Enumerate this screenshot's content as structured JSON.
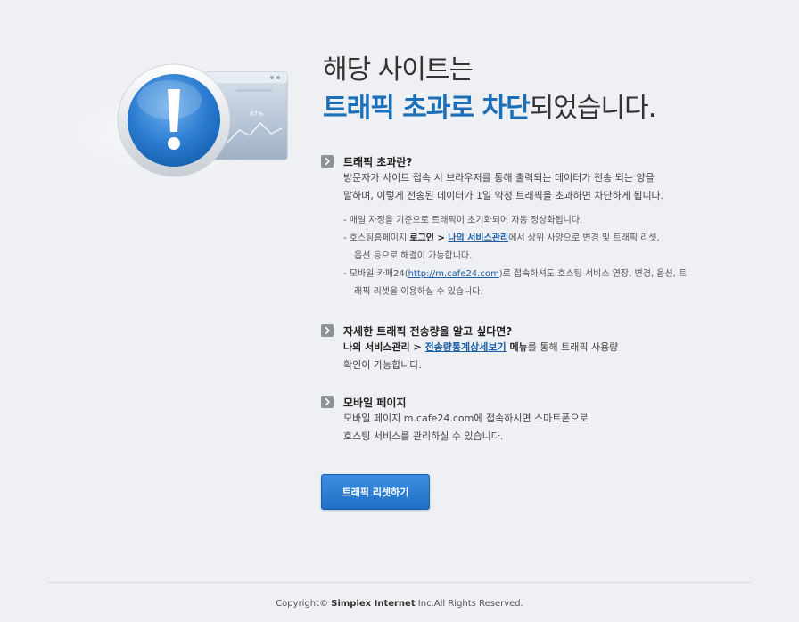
{
  "hero": {
    "title_line1": "해당 사이트는",
    "title_highlight": "트래픽 초과로 차단",
    "title_rest": "되었습니다.",
    "chart_percent": "67%"
  },
  "sections": {
    "what": {
      "title": "트래픽 초과란?",
      "body_line1": "방문자가 사이트 접속 시 브라우저를 통해 출력되는 데이터가 전송 되는 양을",
      "body_line2": "말하며, 이렇게 전송된 데이터가 1일 약정 트래픽을 초과하면 차단하게 됩니다.",
      "note1": "- 매일 자정을 기준으로 트래픽이 초기화되어 자동 정상화됩니다.",
      "note2_prefix": "- 호스팅홈페이지 ",
      "note2_login": "로그인",
      "note2_sep": " > ",
      "note2_link": "나의 서비스관리",
      "note2_suffix": "에서 상위 사양으로 변경 및 트래픽 리셋,",
      "note2_line2": "옵션 등으로 해결이 가능합니다.",
      "note3_prefix": "- 모바일 카페24(",
      "note3_link": "http://m.cafe24.com",
      "note3_suffix": ")로 접속하셔도 호스팅 서비스 연장, 변경, 옵션, 트",
      "note3_line2": "래픽 리셋을 이용하실 수 있습니다."
    },
    "detail": {
      "title": "자세한 트래픽 전송량을 알고 싶다면?",
      "line1_prefix": "나의 서비스관리",
      "line1_sep": " > ",
      "line1_link": "전송량통계상세보기",
      "line1_menu": " 메뉴",
      "line1_suffix": "를 통해 트래픽 사용량",
      "line2": "확인이 가능합니다."
    },
    "mobile": {
      "title": "모바일 페이지",
      "line1": "모바일 페이지 m.cafe24.com에 접속하시면 스마트폰으로",
      "line2": "호스팅 서비스를 관리하실 수 있습니다."
    }
  },
  "button": {
    "reset_label": "트래픽 리셋하기"
  },
  "footer": {
    "prefix": "Copyright© ",
    "company": "Simplex Internet",
    "suffix": " Inc.All Rights Reserved."
  },
  "colors": {
    "accent": "#1a6fb8",
    "link": "#1a5fa8",
    "background": "#eef0f3"
  }
}
